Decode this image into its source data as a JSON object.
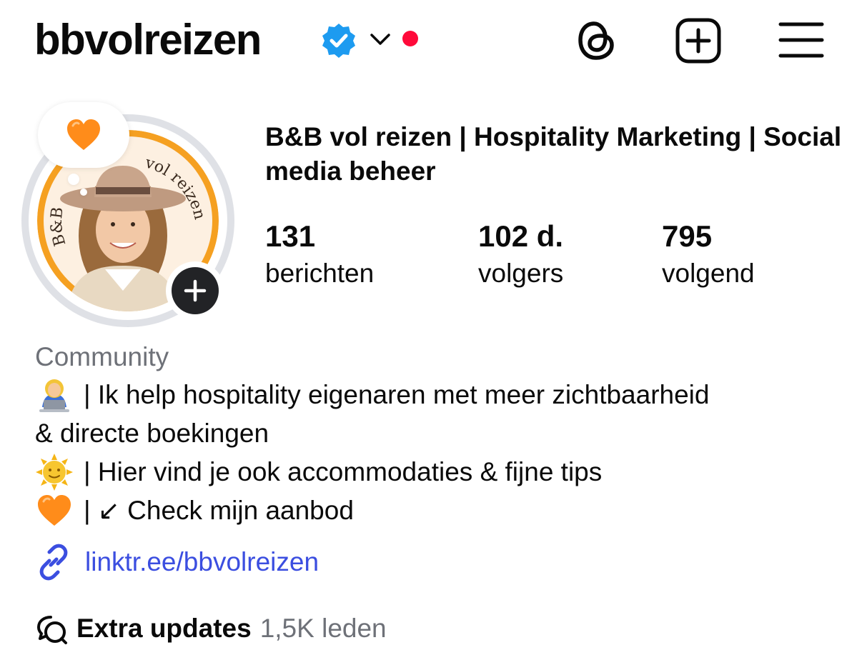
{
  "header": {
    "username": "bbvolreizen",
    "verified_icon": "verified-badge-icon",
    "account_switch_icon": "chevron-down-icon",
    "notification_dot_color": "#ff0a3a",
    "actions": [
      {
        "icon": "threads-icon"
      },
      {
        "icon": "create-post-icon"
      },
      {
        "icon": "menu-icon"
      }
    ]
  },
  "profile": {
    "display_name": "B&B vol reizen | Hospitality Marketing | Social media beheer",
    "avatar_text": "B&B vol reizen",
    "note_icon": "orange-heart-icon",
    "add_story_icon": "plus-icon"
  },
  "stats": [
    {
      "value": "131",
      "label": "berichten"
    },
    {
      "value": "102 d.",
      "label": "volgers"
    },
    {
      "value": "795",
      "label": "volgend"
    }
  ],
  "bio": {
    "category": "Community",
    "lines": [
      {
        "icon": "woman-technologist-icon",
        "text": "| Ik help hospitality eigenaren met meer zichtbaarheid"
      },
      {
        "icon": "",
        "text": "& directe boekingen"
      },
      {
        "icon": "sun-with-face-icon",
        "text": "| Hier vind je ook accommodaties & fijne tips"
      },
      {
        "icon": "orange-heart-icon",
        "text": "| ↙ Check mijn aanbod"
      }
    ],
    "link": {
      "icon": "link-icon",
      "text": "linktr.ee/bbvolreizen"
    },
    "channel": {
      "icon": "broadcast-channel-icon",
      "name": "Extra updates",
      "members": "1,5K leden"
    }
  },
  "colors": {
    "link": "#3b4ee0",
    "verified": "#1d9bf0",
    "avatar_ring": "#f5a021",
    "muted_text": "#6e7178"
  }
}
